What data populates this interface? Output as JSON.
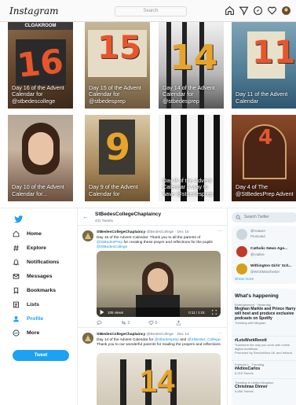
{
  "instagram": {
    "logo": "Instagram",
    "search_placeholder": "Search",
    "nav_icons": [
      "home-icon",
      "direct-icon",
      "explore-icon",
      "heart-icon",
      "profile-avatar"
    ],
    "posts": [
      {
        "caption": "Day 16 of the Advent Calendar for @stbedescollege",
        "number": "16",
        "banner": "CLOAKROOM"
      },
      {
        "caption": "Day 15 of the Advent Calendar for @stbedesprep",
        "number": "15"
      },
      {
        "caption": "Day 14 of the Advent Calendar for @stbedesprep",
        "number": "14"
      },
      {
        "caption": "Day 11 of the Advent Calendar",
        "number": "11"
      },
      {
        "caption": "Day 10 of the Advent Calendar for...",
        "number": ""
      },
      {
        "caption": "Day 9 of the Advent Calendar for",
        "number": "9"
      },
      {
        "caption": "Day 8 of the Advent Calendar A way to have @stbedesprep",
        "number": ""
      },
      {
        "caption": "Day 4 of The @StBedesPrep Advent",
        "number": "4"
      }
    ]
  },
  "twitter": {
    "nav": [
      {
        "label": "Home",
        "icon": "home-icon"
      },
      {
        "label": "Explore",
        "icon": "hashtag-icon"
      },
      {
        "label": "Notifications",
        "icon": "bell-icon"
      },
      {
        "label": "Messages",
        "icon": "mail-icon"
      },
      {
        "label": "Bookmarks",
        "icon": "bookmark-icon"
      },
      {
        "label": "Lists",
        "icon": "list-icon"
      },
      {
        "label": "Profile",
        "icon": "person-icon"
      },
      {
        "label": "More",
        "icon": "more-circle-icon"
      }
    ],
    "tweet_button": "Tweet",
    "profile": {
      "title": "StBedesCollegeChaplaincy",
      "subtitle": "431 Tweets"
    },
    "tweets": [
      {
        "name": "StBedesCollegeChaplaincy",
        "meta": "@BedesCollege · Dec 15",
        "text_a": "Day 15 of the Advent Calendar. Thank you to all the parents of ",
        "link_a": "@StBedesPrep",
        "text_b": " for creating these prayer and reflections for the pupils ",
        "link_b": "@StBedesCollege",
        "video_views": "105 views",
        "video_time": "0:11 / 1:01",
        "replies": "",
        "retweets": "3",
        "likes": "5"
      },
      {
        "name": "StBedesCollegeChaplaincy",
        "meta": "@BedesCollege · Dec 14",
        "text_a": "Day 14 of the Advent Calendar for ",
        "link_a": "@stbedesprep",
        "text_b": " and ",
        "link_b": "@StBedes_College",
        "text_c": ". Thank you to our wonderful parents for reading the prayers and reflections."
      }
    ],
    "right": {
      "search_placeholder": "Search Twitter",
      "follow": [
        {
          "name": "",
          "handle": "@Hoawer",
          "promoted": "Promoted"
        },
        {
          "name": "Catholic News Age...",
          "handle": "@cnalive"
        },
        {
          "name": "Withington Girls' Sch...",
          "handle": "@WGSManchester"
        }
      ],
      "show_more": "Show more",
      "happening_title": "What's happening",
      "trends": [
        {
          "meta": "Entertainment · Yesterday",
          "name": "Meghan Markle and Prince Harry will host and produce exclusive podcasts on Spotify",
          "count": "Trending with Meghan"
        },
        {
          "meta": "",
          "name": "#LetsWorkRevolt",
          "count": "Transform the way you work with online digital workflows"
        },
        {
          "meta": "Promoted by ServiceNow UK and Ireland",
          "name": "",
          "count": ""
        },
        {
          "meta": "Formula 1 · Trending",
          "name": "#AdiosCarlos",
          "count": "6,218 Tweets"
        },
        {
          "meta": "Trending in United Kingdom",
          "name": "Christmas Dinner",
          "count": "5,088 Tweets"
        }
      ]
    }
  },
  "colors": {
    "twitter_blue": "#1da1f2",
    "advent_orange": "#e8552a"
  }
}
